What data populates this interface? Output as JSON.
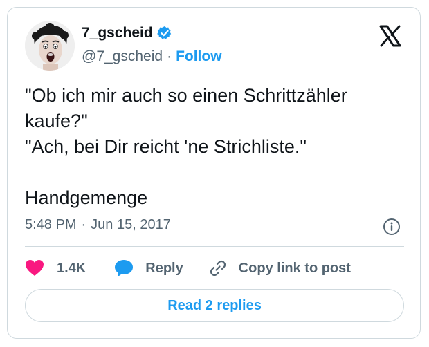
{
  "author": {
    "display_name": "7_gscheid",
    "handle": "@7_gscheid",
    "separator": "·",
    "follow_label": "Follow"
  },
  "tweet": {
    "text": "\"Ob ich mir auch so einen Schrittzähler kaufe?\"\n\"Ach, bei Dir reicht 'ne Strichliste.\"\n\nHandgemenge",
    "time": "5:48 PM",
    "meta_separator": "·",
    "date": "Jun 15, 2017"
  },
  "actions": {
    "like_count": "1.4K",
    "reply_label": "Reply",
    "copy_link_label": "Copy link to post"
  },
  "footer": {
    "read_replies_label": "Read 2 replies"
  },
  "colors": {
    "accent": "#1d9bf0",
    "like": "#f91880",
    "muted_text": "#536471",
    "border": "#cfd9de"
  },
  "icons": {
    "verified": "verified-badge-icon",
    "platform": "x-logo-icon",
    "info": "info-icon",
    "like": "heart-icon",
    "reply": "speech-bubble-icon",
    "copy_link": "link-icon"
  }
}
